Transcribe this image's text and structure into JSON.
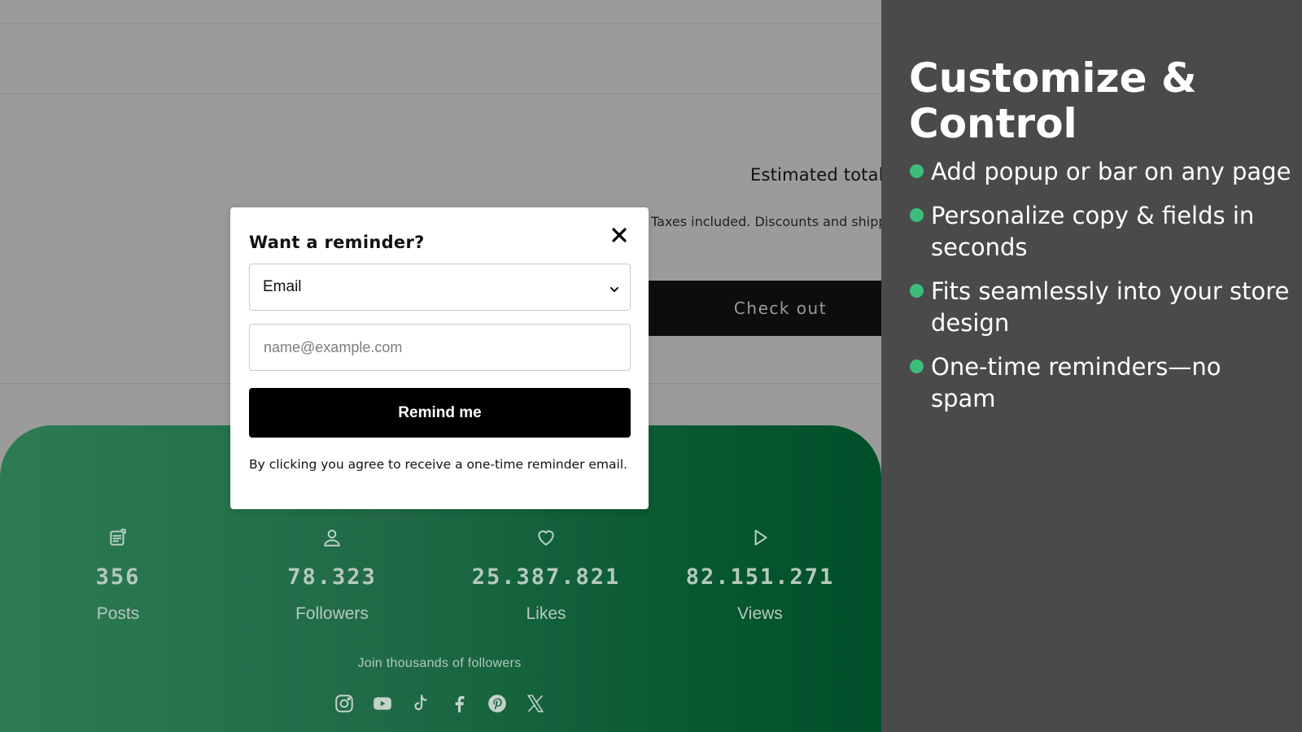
{
  "store": {
    "estimated_total_label": "Estimated total",
    "taxes_note": "Taxes included. Discounts and shipping calculated at checkout.",
    "checkout_label": "Check out"
  },
  "modal": {
    "title": "Want a reminder?",
    "channel_selected": "Email",
    "email_placeholder": "name@example.com",
    "submit_label": "Remind me",
    "consent": "By clicking you agree to receive a one-time reminder email."
  },
  "footer": {
    "stats": [
      {
        "icon": "posts-icon",
        "value": "356",
        "label": "Posts"
      },
      {
        "icon": "user-icon",
        "value": "78.323",
        "label": "Followers"
      },
      {
        "icon": "heart-icon",
        "value": "25.387.821",
        "label": "Likes"
      },
      {
        "icon": "play-icon",
        "value": "82.151.271",
        "label": "Views"
      }
    ],
    "join_text": "Join thousands of followers",
    "socials": [
      "instagram-icon",
      "youtube-icon",
      "tiktok-icon",
      "facebook-icon",
      "pinterest-icon",
      "x-icon"
    ]
  },
  "panel": {
    "title": "Customize & Control",
    "features": [
      "Add popup or bar on any page",
      "Personalize copy & fields in seconds",
      "Fits seamlessly into your store design",
      "One-time reminders—no spam"
    ]
  },
  "colors": {
    "overlay_gray": "#9b9b9b",
    "footer_green": "#1f6a44",
    "panel_bg": "#4a4a4a",
    "bullet_green": "#3dbd7a"
  }
}
